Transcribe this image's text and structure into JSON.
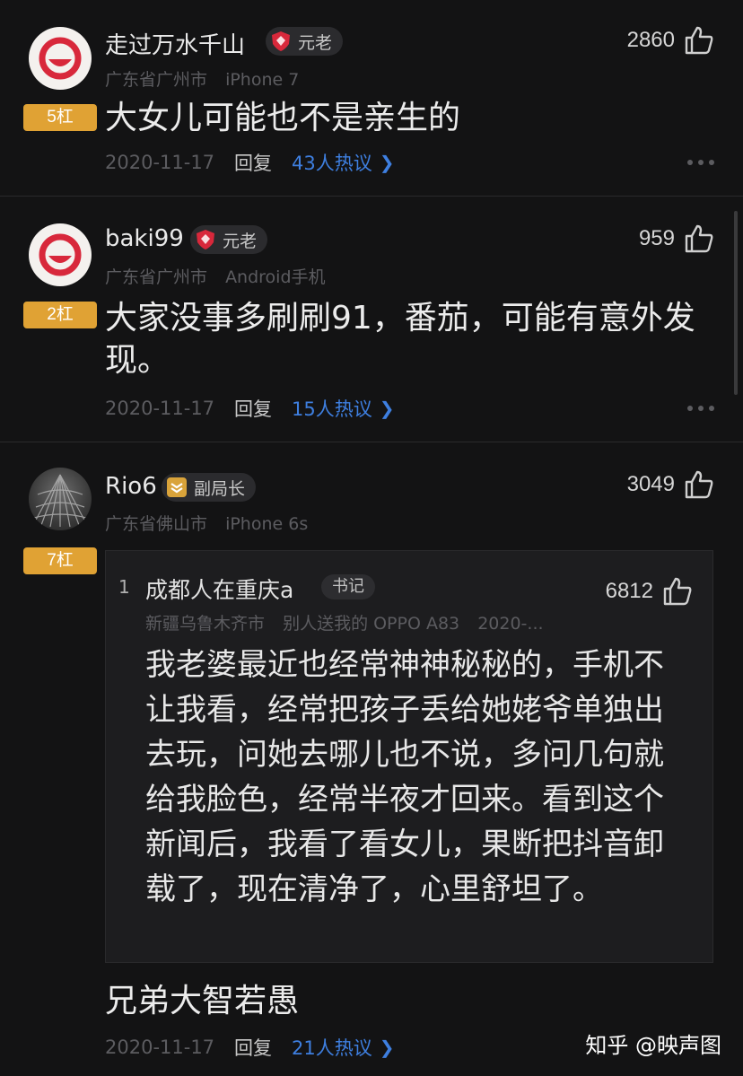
{
  "comments": [
    {
      "username": "走过万水千山",
      "rank": "元老",
      "location": "广东省广州市",
      "device": "iPhone 7",
      "likes": "2860",
      "gang": "5杠",
      "text": "大女儿可能也不是亲生的",
      "date": "2020-11-17",
      "reply_label": "回复",
      "hot_label": "43人热议",
      "avatar_icon": "neteasy-logo-icon",
      "rank_icon": "red-shield-icon"
    },
    {
      "username": "baki99",
      "rank": "元老",
      "location": "广东省广州市",
      "device": "Android手机",
      "likes": "959",
      "gang": "2杠",
      "text": "大家没事多刷刷91，番茄，可能有意外发现。",
      "date": "2020-11-17",
      "reply_label": "回复",
      "hot_label": "15人热议",
      "avatar_icon": "neteasy-logo-icon",
      "rank_icon": "red-shield-icon"
    },
    {
      "username": "Rio6",
      "rank": "副局长",
      "location": "广东省佛山市",
      "device": "iPhone 6s",
      "likes": "3049",
      "gang": "7杠",
      "text": "兄弟大智若愚",
      "date": "2020-11-17",
      "reply_label": "回复",
      "hot_label": "21人热议",
      "avatar_icon": "architecture-photo-icon",
      "rank_icon": "gold-chevron-icon",
      "quote": {
        "index": "1",
        "username": "成都人在重庆a",
        "badge": "书记",
        "location": "新疆乌鲁木齐市",
        "device": "别人送我的 OPPO A83",
        "date": "2020-...",
        "likes": "6812",
        "text": "我老婆最近也经常神神秘秘的，手机不让我看，经常把孩子丢给她姥爷单独出去玩，问她去哪儿也不说，多问几句就给我脸色，经常半夜才回来。看到这个新闻后，我看了看女儿，果断把抖音卸载了，现在清净了，心里舒坦了。"
      }
    }
  ],
  "watermark": "知乎 @映声图",
  "colors": {
    "background": "#131314",
    "gang_badge": "#e0a234",
    "hot_link": "#3e7fe0",
    "rank_red": "#d8283b",
    "rank_gold": "#d9a33a"
  }
}
